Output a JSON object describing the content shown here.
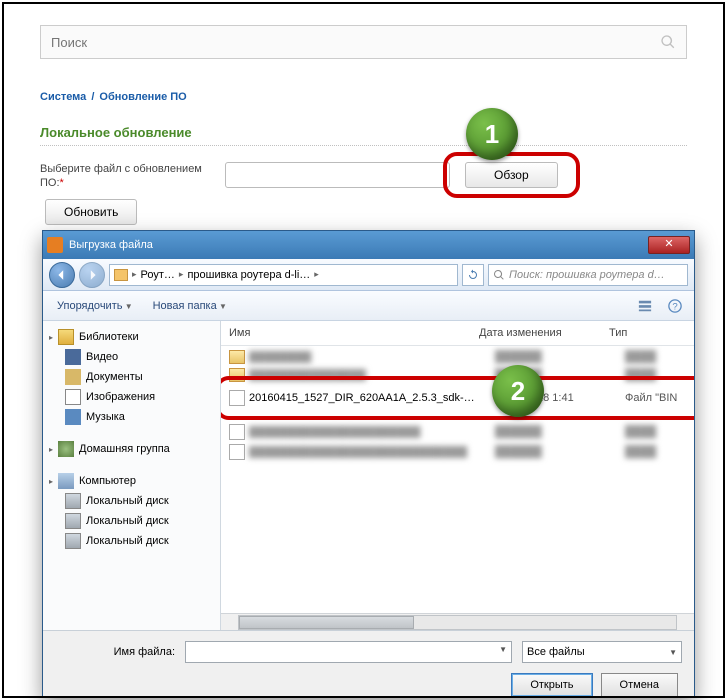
{
  "page": {
    "search_placeholder": "Поиск",
    "breadcrumb": {
      "a": "Система",
      "sep": "/",
      "b": "Обновление ПО"
    },
    "section_title": "Локальное обновление",
    "file_label": "Выберите файл с обновлением ПО:",
    "required_mark": "*",
    "browse_label": "Обзор",
    "update_label": "Обновить"
  },
  "callouts": {
    "one": "1",
    "two": "2"
  },
  "dialog": {
    "title": "Выгрузка файла",
    "close_glyph": "✕",
    "path": {
      "seg1": "Роут…",
      "seg2": "прошивка роутера d-li…"
    },
    "nav_search_placeholder": "Поиск: прошивка роутера d…",
    "toolbar": {
      "organize": "Упорядочить",
      "new_folder": "Новая папка"
    },
    "sidebar": {
      "libraries": "Библиотеки",
      "video": "Видео",
      "documents": "Документы",
      "images": "Изображения",
      "music": "Музыка",
      "homegroup": "Домашняя группа",
      "computer": "Компьютер",
      "drive1": "Локальный диск",
      "drive2": "Локальный диск",
      "drive3": "Локальный диск"
    },
    "columns": {
      "name": "Имя",
      "date": "Дата изменения",
      "type": "Тип"
    },
    "rows": [
      {
        "name": "████████",
        "date": "██████",
        "type": "████",
        "blur": true,
        "folder": true
      },
      {
        "name": "███████████████",
        "date": "██████",
        "type": "████",
        "blur": true,
        "folder": true
      },
      {
        "name": "20160415_1527_DIR_620AA1A_2.5.3_sdk-…",
        "date": "08.11.2018 1:41",
        "type": "Файл \"BIN",
        "blur": false,
        "folder": false,
        "highlight": true
      },
      {
        "name": "██████████████████████",
        "date": "██████",
        "type": "████",
        "blur": true,
        "folder": false
      },
      {
        "name": "████████████████████████████",
        "date": "██████",
        "type": "████",
        "blur": true,
        "folder": false
      }
    ],
    "footer": {
      "filename_label": "Имя файла:",
      "filter": "Все файлы",
      "open": "Открыть",
      "cancel": "Отмена"
    }
  }
}
